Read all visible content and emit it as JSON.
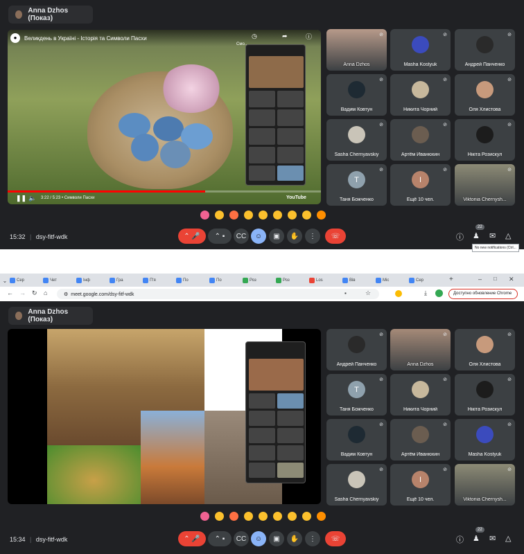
{
  "top": {
    "presenter": "Anna Dzhos (Показ)",
    "video": {
      "title": "Великдень в Україні - Історія та Символи Пасхи",
      "time": "3:22 / 5:23 • Символи Пасхи",
      "brand": "YouTube",
      "side_label": "Смо..."
    },
    "participants": [
      {
        "name": "Anna Dzhos",
        "initial": "",
        "color": "#b79a8a",
        "video": true
      },
      {
        "name": "Masha Kostyuk",
        "initial": "",
        "color": "#3b4bbd",
        "video": false
      },
      {
        "name": "Андрей Панченко",
        "initial": "",
        "color": "#2a2a2a",
        "video": false
      },
      {
        "name": "Вадим Ковтун",
        "initial": "",
        "color": "#1e2a33",
        "video": false
      },
      {
        "name": "Никита Чорний",
        "initial": "",
        "color": "#c7b89c",
        "video": false
      },
      {
        "name": "Оля Хлистова",
        "initial": "",
        "color": "#c79a7c",
        "video": false
      },
      {
        "name": "Sasha Chernyavskiy",
        "initial": "",
        "color": "#c9c4b8",
        "video": false
      },
      {
        "name": "Артём Иванюхин",
        "initial": "",
        "color": "#6b5d50",
        "video": false
      },
      {
        "name": "Нікіта Розискул",
        "initial": "",
        "color": "#1c1c1c",
        "video": false
      },
      {
        "name": "Таня Божченко",
        "initial": "T",
        "color": "#8fa1ad",
        "video": false
      },
      {
        "name": "Ещё 10 чел.",
        "initial": "I",
        "color": "#b7836b",
        "video": false
      },
      {
        "name": "Viktoriia Chernysh...",
        "initial": "",
        "color": "#8d8b76",
        "video": true
      }
    ],
    "time": "15:32",
    "meeting_code": "dsy-fitf-wdk",
    "participant_count": "22",
    "tooltip": "No new notifications (Ctrl..."
  },
  "chrome": {
    "tabs": [
      "Сер",
      "Чет",
      "Інф",
      "Гра",
      "П'я",
      "По",
      "По",
      "Роз",
      "Роз",
      "Los",
      "Вів",
      "Mic",
      "Сер"
    ],
    "url": "meet.google.com/dsy-fitf-wdk",
    "update_label": "Доступно обновление Chrome"
  },
  "bottom": {
    "presenter": "Anna Dzhos (Показ)",
    "participants": [
      {
        "name": "Андрей Панченко",
        "initial": "",
        "color": "#2a2a2a",
        "video": false
      },
      {
        "name": "Anna Dzhos",
        "initial": "",
        "color": "#a58a78",
        "video": true
      },
      {
        "name": "Оля Хлистова",
        "initial": "",
        "color": "#c79a7c",
        "video": false
      },
      {
        "name": "Таня Божченко",
        "initial": "T",
        "color": "#8fa1ad",
        "video": false
      },
      {
        "name": "Никита Чорний",
        "initial": "",
        "color": "#c7b89c",
        "video": false
      },
      {
        "name": "Нікіта Розискул",
        "initial": "",
        "color": "#1c1c1c",
        "video": false
      },
      {
        "name": "Вадим Ковтун",
        "initial": "",
        "color": "#1e2a33",
        "video": false
      },
      {
        "name": "Артём Иванюхин",
        "initial": "",
        "color": "#6b5d50",
        "video": false
      },
      {
        "name": "Masha Kostyuk",
        "initial": "",
        "color": "#3b4bbd",
        "video": false
      },
      {
        "name": "Sasha Chernyavskiy",
        "initial": "",
        "color": "#c9c4b8",
        "video": false
      },
      {
        "name": "Ещё 10 чел.",
        "initial": "I",
        "color": "#b7836b",
        "video": false
      },
      {
        "name": "Viktoriia Chernysh...",
        "initial": "",
        "color": "#8d8b76",
        "video": true
      }
    ],
    "time": "15:34",
    "meeting_code": "dsy-fitf-wdk",
    "participant_count": "22"
  },
  "reaction_colors": [
    "#f06292",
    "#fbc02d",
    "#ff7043",
    "#fbc02d",
    "#fbc02d",
    "#fbc02d",
    "#fbc02d",
    "#fbc02d",
    "#ff8f00"
  ],
  "colors": {
    "bg": "#202124",
    "tile": "#3c4043",
    "end_call": "#ea4335",
    "accent": "#8ab4f8"
  }
}
